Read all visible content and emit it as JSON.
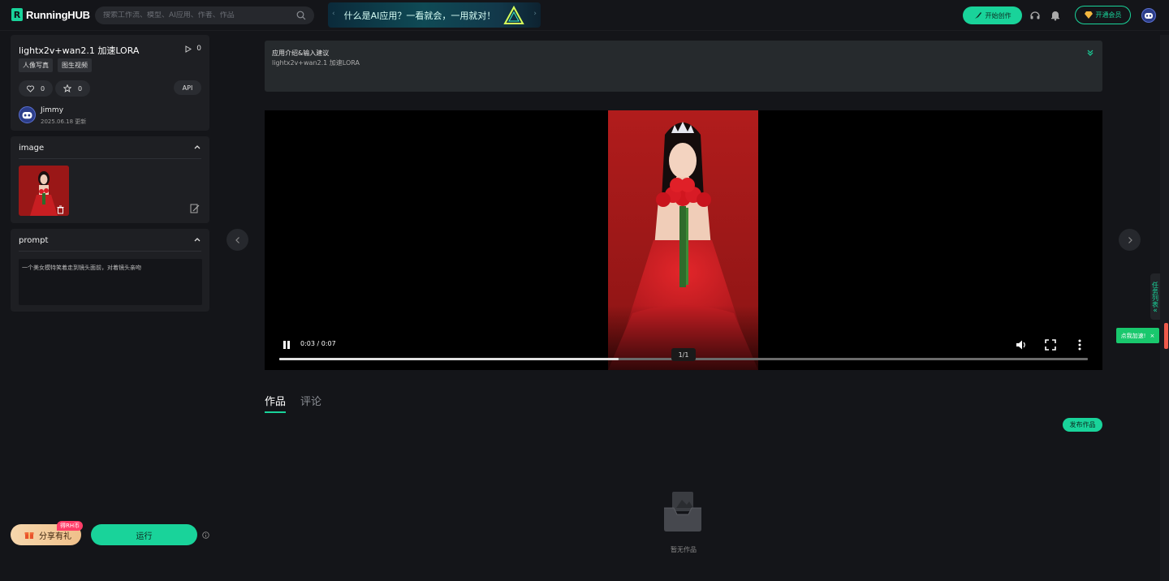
{
  "header": {
    "logo_text": "RunningHUB",
    "logo_mark": "R",
    "search_placeholder": "搜索工作流、模型、AI应用、作者、作品",
    "banner_text": "什么是AI应用？一看就会，一用就对！",
    "start_label": "开始创作",
    "vip_label": "开通会员",
    "icons": [
      "search-icon",
      "brush-icon",
      "headset-icon",
      "bell-icon",
      "diamond-icon",
      "avatar"
    ]
  },
  "app": {
    "title": "lightx2v+wan2.1 加速LORA",
    "play_count": "0",
    "tags": [
      "人像写真",
      "图生视频"
    ],
    "likes": "0",
    "favorites": "0",
    "api_label": "API",
    "author": "Jimmy",
    "updated": "2025.06.18 更新"
  },
  "inputs": {
    "image_label": "image",
    "prompt_label": "prompt",
    "prompt_text": "一个美女模特笑着走到镜头面前，对着镜头亲吻"
  },
  "bottom": {
    "share_label": "分享有礼",
    "share_badge": "得RH币",
    "run_label": "运行"
  },
  "intro": {
    "title": "应用介绍&输入建议",
    "body": "lightx2v+wan2.1 加速LORA"
  },
  "video": {
    "time": "0:03 / 0:07",
    "progress": 0.42,
    "counter": "1/1"
  },
  "tabs": [
    {
      "label": "作品",
      "active": true
    },
    {
      "label": "评论",
      "active": false
    }
  ],
  "works": {
    "publish_label": "发布作品",
    "empty_text": "暂无作品"
  },
  "side": {
    "task_list_label": "任务列表",
    "speed_label": "点我加速!",
    "speed_close": "×"
  },
  "colors": {
    "accent": "#19d39a",
    "background": "#141519",
    "card": "#1e1f23",
    "share_gradient": "#f6d7ad",
    "badge": "#ff3d68"
  }
}
